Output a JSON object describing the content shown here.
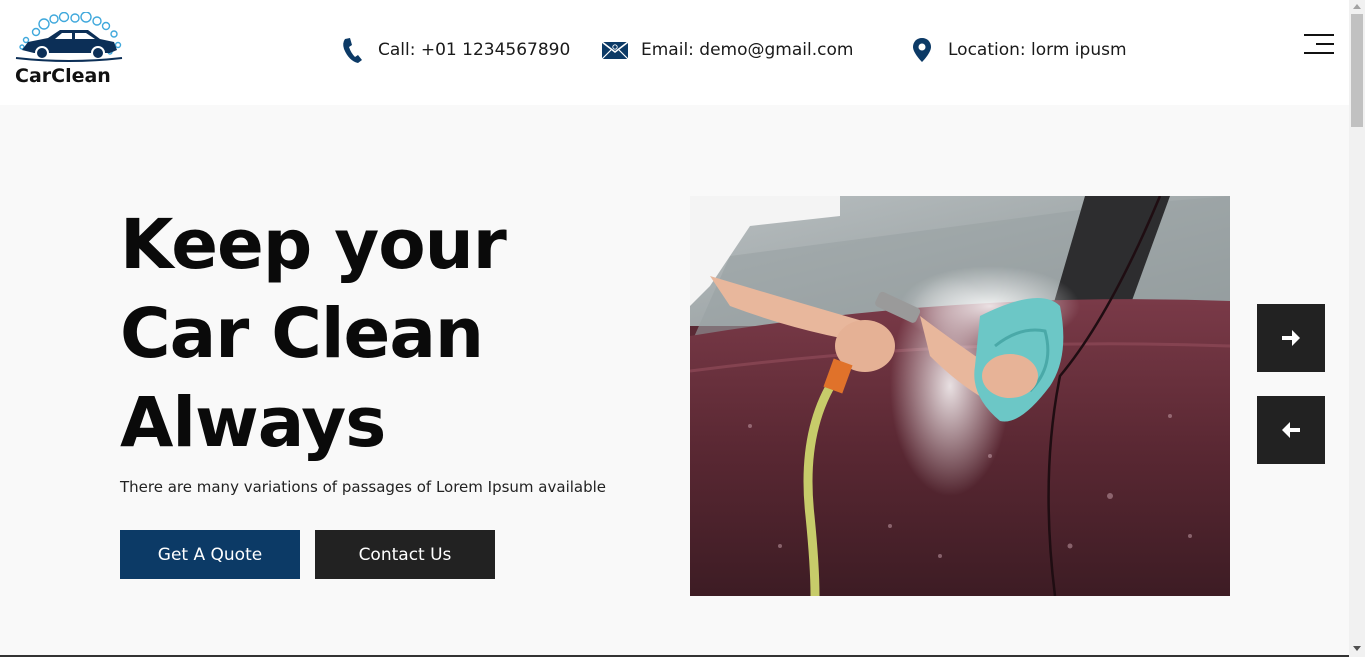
{
  "brand": {
    "name": "CarClean",
    "accent_color": "#0c3a66"
  },
  "header": {
    "contacts": [
      {
        "icon": "phone-icon",
        "label": "Call: +01 1234567890"
      },
      {
        "icon": "email-icon",
        "label": "Email: demo@gmail.com"
      },
      {
        "icon": "location-icon",
        "label": "Location: lorm ipusm"
      }
    ],
    "menu_icon": "hamburger-menu-icon"
  },
  "hero": {
    "title_lines": [
      "Keep your",
      "Car Clean",
      "Always"
    ],
    "subtitle": "There are many variations of passages of Lorem Ipsum available",
    "buttons": {
      "quote_label": "Get A Quote",
      "contact_label": "Contact Us"
    },
    "slider": {
      "next_icon": "arrow-right-icon",
      "prev_icon": "arrow-left-icon"
    },
    "image_subject": "Person washing a red car with a hose and cloth"
  },
  "colors": {
    "primary_button": "#0c3a66",
    "dark_button": "#222222",
    "hero_background": "#f9f9f9"
  }
}
